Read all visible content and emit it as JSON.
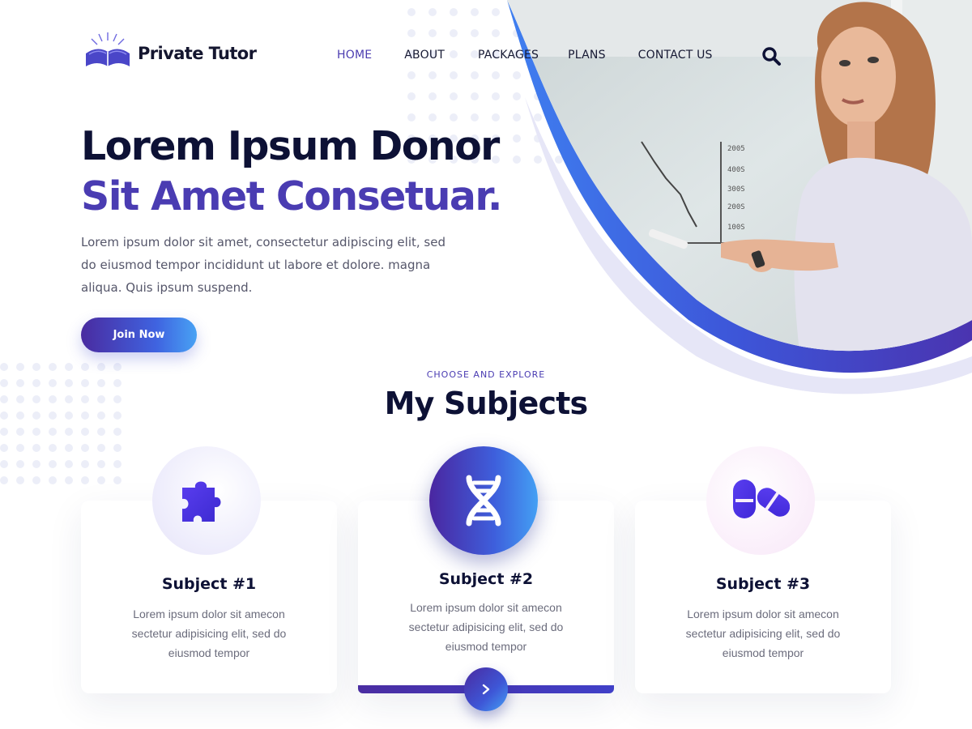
{
  "brand": {
    "name": "Private Tutor",
    "logo_icon": "open-book-sunrise-icon"
  },
  "nav": {
    "items": [
      {
        "label": "HOME",
        "active": true
      },
      {
        "label": "ABOUT",
        "active": false
      },
      {
        "label": "PACKAGES",
        "active": false
      },
      {
        "label": "PLANS",
        "active": false
      },
      {
        "label": "CONTACT US",
        "active": false
      }
    ],
    "search_icon": "search-icon"
  },
  "hero": {
    "title_line1": "Lorem Ipsum Donor",
    "title_line2": "Sit Amet Consetuar.",
    "description": "Lorem ipsum dolor sit amet, consectetur  adipiscing elit, sed do eiusmod tempor  incididunt ut labore et dolore. magna aliqua. Quis ipsum suspend.",
    "cta_label": "Join Now"
  },
  "subjects": {
    "eyebrow": "CHOOSE AND EXPLORE",
    "title": "My Subjects",
    "cards": [
      {
        "title": "Subject #1",
        "description": "Lorem ipsum dolor sit amecon sectetur adipisicing elit, sed do eiusmod tempor",
        "icon": "puzzle-piece-icon"
      },
      {
        "title": "Subject #2",
        "description": "Lorem ipsum dolor sit amecon sectetur adipisicing elit, sed do eiusmod tempor",
        "icon": "dna-icon",
        "active": true
      },
      {
        "title": "Subject #3",
        "description": "Lorem ipsum dolor sit amecon sectetur adipisicing elit, sed do eiusmod tempor",
        "icon": "pills-icon"
      }
    ],
    "next_icon": "chevron-right-icon"
  },
  "colors": {
    "primary": "#4a3cb2",
    "dark": "#0d1135",
    "gradient_start": "#4a2aa0",
    "gradient_end": "#44a0f4",
    "text_muted": "#55566a"
  },
  "whiteboard_chart_labels": [
    "2005",
    "400S",
    "300S",
    "200S",
    "100S"
  ]
}
